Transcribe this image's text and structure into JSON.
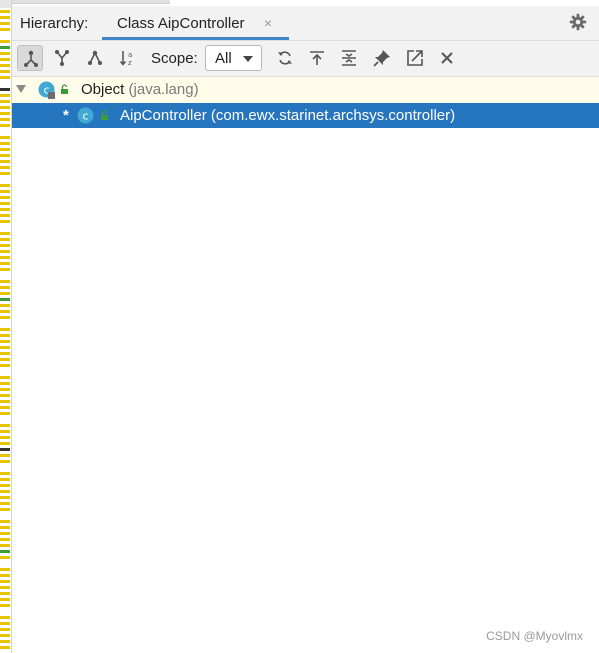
{
  "header": {
    "hierarchy_label": "Hierarchy:",
    "tab_label": "Class AipController",
    "tab_close": "×",
    "settings_icon": "gear-icon"
  },
  "toolbar": {
    "buttons": [
      {
        "name": "class-hierarchy-icon",
        "active": true
      },
      {
        "name": "supertypes-hierarchy-icon",
        "active": false
      },
      {
        "name": "subtypes-hierarchy-icon",
        "active": false
      },
      {
        "name": "sort-alphabetically-icon",
        "active": false
      },
      {
        "name": "refresh-icon",
        "active": false
      },
      {
        "name": "base-on-this-class-icon",
        "active": false
      },
      {
        "name": "expand-all-icon",
        "active": false
      },
      {
        "name": "pin-tab-icon",
        "active": false
      },
      {
        "name": "export-icon",
        "active": false
      },
      {
        "name": "close-icon",
        "active": false
      }
    ],
    "scope_label": "Scope:",
    "scope_value": "All"
  },
  "tree": {
    "rows": [
      {
        "name": "Object",
        "package": "(java.lang)",
        "selected": false,
        "expanded": true
      },
      {
        "marker": "*",
        "name": "AipController",
        "package": "(com.ewx.starinet.archsys.controller)",
        "selected": true
      }
    ]
  },
  "watermark": "CSDN @Myovlmx",
  "colors": {
    "selection": "#2675bf",
    "root_row_bg": "#fffdea",
    "tab_underline": "#4083c9",
    "class_icon": "#3fa9d3"
  }
}
